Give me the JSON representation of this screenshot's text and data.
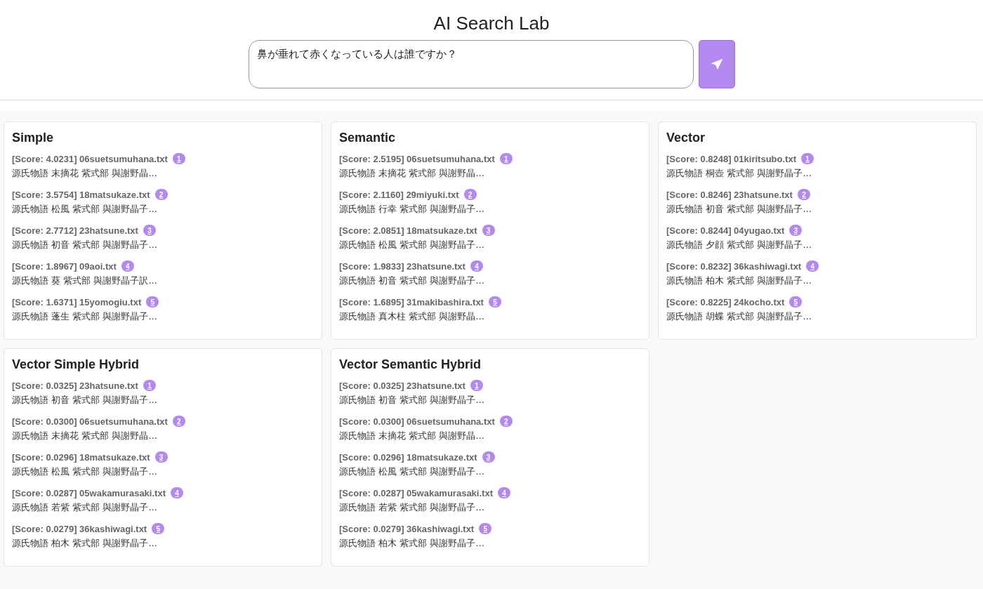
{
  "title": "AI Search Lab",
  "query": {
    "value": "鼻が垂れて赤くなっている人は誰ですか？"
  },
  "panels": [
    {
      "title": "Simple",
      "results": [
        {
          "score": "[Score: 4.0231] 06suetsumuhana.txt",
          "rank": "1",
          "snippet": "源氏物語 末摘花 紫式部 與謝野晶..."
        },
        {
          "score": "[Score: 3.5754] 18matsukaze.txt",
          "rank": "2",
          "snippet": "源氏物語 松風 紫式部 與謝野晶子..."
        },
        {
          "score": "[Score: 2.7712] 23hatsune.txt",
          "rank": "3",
          "snippet": "源氏物語 初音 紫式部 與謝野晶子..."
        },
        {
          "score": "[Score: 1.8967] 09aoi.txt",
          "rank": "4",
          "snippet": "源氏物語 葵 紫式部 與謝野晶子訳..."
        },
        {
          "score": "[Score: 1.6371] 15yomogiu.txt",
          "rank": "5",
          "snippet": "源氏物語 蓬生 紫式部 與謝野晶子..."
        }
      ]
    },
    {
      "title": "Semantic",
      "results": [
        {
          "score": "[Score: 2.5195] 06suetsumuhana.txt",
          "rank": "1",
          "snippet": "源氏物語 末摘花 紫式部 與謝野晶..."
        },
        {
          "score": "[Score: 2.1160] 29miyuki.txt",
          "rank": "2",
          "snippet": "源氏物語 行幸 紫式部 與謝野晶子..."
        },
        {
          "score": "[Score: 2.0851] 18matsukaze.txt",
          "rank": "3",
          "snippet": "源氏物語 松風 紫式部 與謝野晶子..."
        },
        {
          "score": "[Score: 1.9833] 23hatsune.txt",
          "rank": "4",
          "snippet": "源氏物語 初音 紫式部 與謝野晶子..."
        },
        {
          "score": "[Score: 1.6895] 31makibashira.txt",
          "rank": "5",
          "snippet": "源氏物語 真木柱 紫式部 與謝野晶..."
        }
      ]
    },
    {
      "title": "Vector",
      "results": [
        {
          "score": "[Score: 0.8248] 01kiritsubo.txt",
          "rank": "1",
          "snippet": "源氏物語 桐壺 紫式部 與謝野晶子..."
        },
        {
          "score": "[Score: 0.8246] 23hatsune.txt",
          "rank": "2",
          "snippet": "源氏物語 初音 紫式部 與謝野晶子..."
        },
        {
          "score": "[Score: 0.8244] 04yugao.txt",
          "rank": "3",
          "snippet": "源氏物語 夕顔 紫式部 與謝野晶子..."
        },
        {
          "score": "[Score: 0.8232] 36kashiwagi.txt",
          "rank": "4",
          "snippet": "源氏物語 柏木 紫式部 與謝野晶子..."
        },
        {
          "score": "[Score: 0.8225] 24kocho.txt",
          "rank": "5",
          "snippet": "源氏物語 胡蝶 紫式部 與謝野晶子..."
        }
      ]
    },
    {
      "title": "Vector Simple Hybrid",
      "results": [
        {
          "score": "[Score: 0.0325] 23hatsune.txt",
          "rank": "1",
          "snippet": "源氏物語 初音 紫式部 與謝野晶子..."
        },
        {
          "score": "[Score: 0.0300] 06suetsumuhana.txt",
          "rank": "2",
          "snippet": "源氏物語 末摘花 紫式部 與謝野晶..."
        },
        {
          "score": "[Score: 0.0296] 18matsukaze.txt",
          "rank": "3",
          "snippet": "源氏物語 松風 紫式部 與謝野晶子..."
        },
        {
          "score": "[Score: 0.0287] 05wakamurasaki.txt",
          "rank": "4",
          "snippet": "源氏物語 若紫 紫式部 與謝野晶子..."
        },
        {
          "score": "[Score: 0.0279] 36kashiwagi.txt",
          "rank": "5",
          "snippet": "源氏物語 柏木 紫式部 與謝野晶子..."
        }
      ]
    },
    {
      "title": "Vector Semantic Hybrid",
      "results": [
        {
          "score": "[Score: 0.0325] 23hatsune.txt",
          "rank": "1",
          "snippet": "源氏物語 初音 紫式部 與謝野晶子..."
        },
        {
          "score": "[Score: 0.0300] 06suetsumuhana.txt",
          "rank": "2",
          "snippet": "源氏物語 末摘花 紫式部 與謝野晶..."
        },
        {
          "score": "[Score: 0.0296] 18matsukaze.txt",
          "rank": "3",
          "snippet": "源氏物語 松風 紫式部 與謝野晶子..."
        },
        {
          "score": "[Score: 0.0287] 05wakamurasaki.txt",
          "rank": "4",
          "snippet": "源氏物語 若紫 紫式部 與謝野晶子..."
        },
        {
          "score": "[Score: 0.0279] 36kashiwagi.txt",
          "rank": "5",
          "snippet": "源氏物語 柏木 紫式部 與謝野晶子..."
        }
      ]
    }
  ]
}
